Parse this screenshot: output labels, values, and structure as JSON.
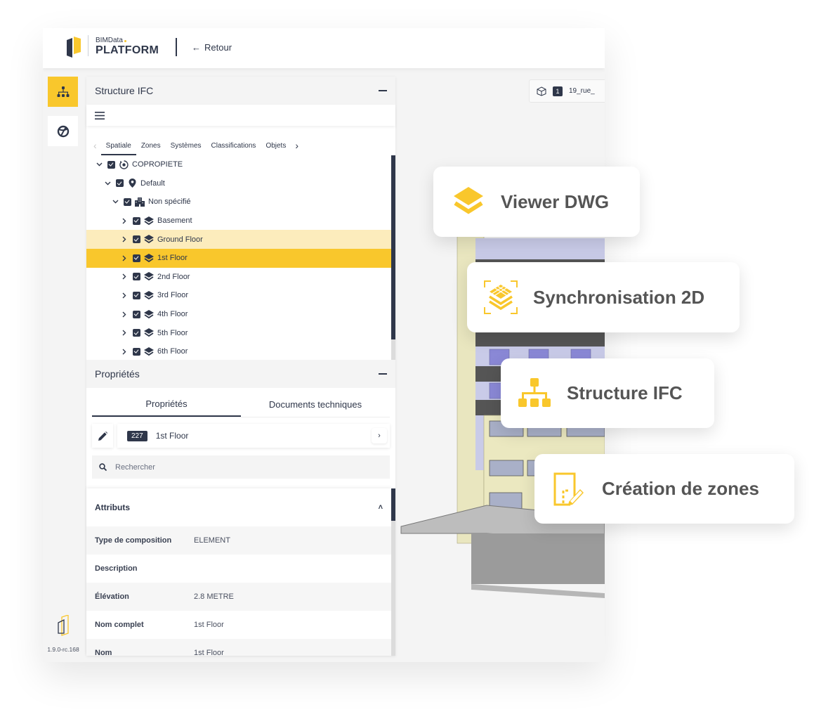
{
  "header": {
    "brand_small": "BIMData",
    "brand_big": "PLATFORM",
    "back_label": "Retour"
  },
  "sidebar": {
    "version": "1.9.0-rc.168"
  },
  "structure_panel": {
    "title": "Structure IFC",
    "tabs": [
      "Spatiale",
      "Zones",
      "Systèmes",
      "Classifications",
      "Objets"
    ],
    "active_tab": "Spatiale",
    "tree": [
      {
        "label": "COPROPIETE",
        "level": 0,
        "icon": "site-icon",
        "expanded": true,
        "checked": true
      },
      {
        "label": "Default",
        "level": 1,
        "icon": "location-pin-icon",
        "expanded": true,
        "checked": true
      },
      {
        "label": "Non spécifié",
        "level": 2,
        "icon": "building-icon",
        "expanded": true,
        "checked": true
      },
      {
        "label": "Basement",
        "level": 3,
        "icon": "layers-icon",
        "expanded": false,
        "checked": true
      },
      {
        "label": "Ground Floor",
        "level": 3,
        "icon": "layers-icon",
        "expanded": false,
        "checked": true,
        "state": "hover"
      },
      {
        "label": "1st Floor",
        "level": 3,
        "icon": "layers-icon",
        "expanded": false,
        "checked": true,
        "state": "selected"
      },
      {
        "label": "2nd Floor",
        "level": 3,
        "icon": "layers-icon",
        "expanded": false,
        "checked": true
      },
      {
        "label": "3rd Floor",
        "level": 3,
        "icon": "layers-icon",
        "expanded": false,
        "checked": true
      },
      {
        "label": "4th Floor",
        "level": 3,
        "icon": "layers-icon",
        "expanded": false,
        "checked": true
      },
      {
        "label": "5th Floor",
        "level": 3,
        "icon": "layers-icon",
        "expanded": false,
        "checked": true
      },
      {
        "label": "6th Floor",
        "level": 3,
        "icon": "layers-icon",
        "expanded": false,
        "checked": true
      }
    ]
  },
  "properties_panel": {
    "title": "Propriétés",
    "tabs": [
      "Propriétés",
      "Documents techniques"
    ],
    "active_tab": "Propriétés",
    "element_id": "227",
    "element_name": "1st Floor",
    "search_placeholder": "Rechercher",
    "section_title": "Attributs",
    "attributes": [
      {
        "key": "Type de composition",
        "value": "ELEMENT"
      },
      {
        "key": "Description",
        "value": ""
      },
      {
        "key": "Élévation",
        "value": "2.8 METRE"
      },
      {
        "key": "Nom complet",
        "value": "1st Floor"
      },
      {
        "key": "Nom",
        "value": "1st Floor"
      }
    ]
  },
  "viewer": {
    "model_count": "1",
    "model_name": "19_rue_"
  },
  "feature_cards": [
    {
      "label": "Viewer DWG",
      "icon": "layers-icon"
    },
    {
      "label": "Synchronisation 2D",
      "icon": "sync-2d-icon"
    },
    {
      "label": "Structure IFC",
      "icon": "hierarchy-icon"
    },
    {
      "label": "Création de zones",
      "icon": "zone-edit-icon"
    }
  ],
  "colors": {
    "accent": "#f9c72c",
    "accent_light": "#fcecbc",
    "primary_dark": "#2f374a",
    "card_text": "#555555"
  }
}
